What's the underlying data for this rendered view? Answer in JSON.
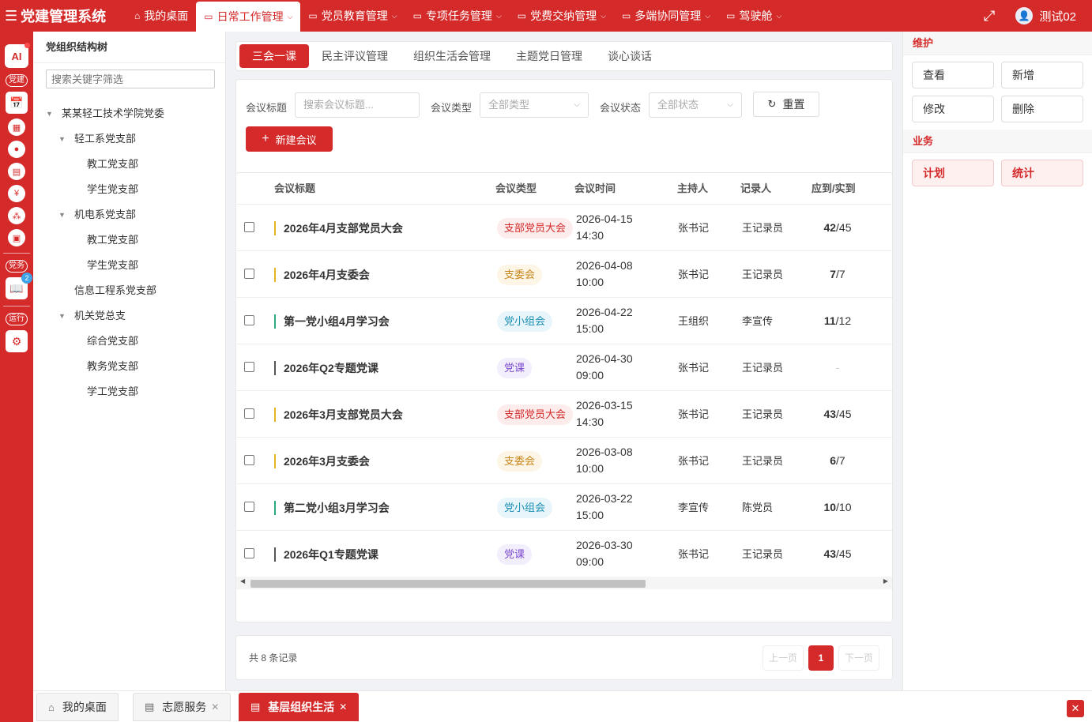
{
  "app": {
    "title": "党建管理系统",
    "username": "测试02"
  },
  "topnav": [
    {
      "label": "我的桌面",
      "icon": "home-icon"
    },
    {
      "label": "日常工作管理",
      "icon": "folder-icon",
      "active": true,
      "has_menu": true
    },
    {
      "label": "党员教育管理",
      "icon": "folder-icon",
      "has_menu": true
    },
    {
      "label": "专项任务管理",
      "icon": "folder-icon",
      "has_menu": true
    },
    {
      "label": "党费交纳管理",
      "icon": "folder-icon",
      "has_menu": true
    },
    {
      "label": "多端协同管理",
      "icon": "folder-icon",
      "has_menu": true
    },
    {
      "label": "驾驶舱",
      "icon": "folder-icon",
      "has_menu": true
    }
  ],
  "leftbar": {
    "ai_label": "AI",
    "section1": "党建",
    "section2": "党务",
    "section3": "运行",
    "badge": "2"
  },
  "tree": {
    "title": "党组织结构树",
    "search_placeholder": "搜索关键字筛选",
    "nodes": [
      {
        "label": "某某轻工技术学院党委",
        "level": 0,
        "caret": true
      },
      {
        "label": "轻工系党支部",
        "level": 1,
        "caret": true
      },
      {
        "label": "教工党支部",
        "level": 2,
        "caret": false
      },
      {
        "label": "学生党支部",
        "level": 2,
        "caret": false
      },
      {
        "label": "机电系党支部",
        "level": 1,
        "caret": true
      },
      {
        "label": "教工党支部",
        "level": 2,
        "caret": false
      },
      {
        "label": "学生党支部",
        "level": 2,
        "caret": false
      },
      {
        "label": "信息工程系党支部",
        "level": 1,
        "caret": false
      },
      {
        "label": "机关党总支",
        "level": 1,
        "caret": true
      },
      {
        "label": "综合党支部",
        "level": 2,
        "caret": false
      },
      {
        "label": "教务党支部",
        "level": 2,
        "caret": false
      },
      {
        "label": "学工党支部",
        "level": 2,
        "caret": false
      }
    ]
  },
  "subtabs": [
    {
      "label": "三会一课",
      "active": true
    },
    {
      "label": "民主评议管理"
    },
    {
      "label": "组织生活会管理"
    },
    {
      "label": "主题党日管理"
    },
    {
      "label": "谈心谈话"
    }
  ],
  "filters": {
    "title_label": "会议标题",
    "title_placeholder": "搜索会议标题...",
    "type_label": "会议类型",
    "type_value": "全部类型",
    "status_label": "会议状态",
    "status_value": "全部状态",
    "reset_label": "重置",
    "new_label": "新建会议"
  },
  "table": {
    "headers": {
      "title": "会议标题",
      "type": "会议类型",
      "time": "会议时间",
      "host": "主持人",
      "recorder": "记录人",
      "attendance": "应到/实到"
    },
    "rows": [
      {
        "title": "2026年4月支部党员大会",
        "type": "支部党员大会",
        "date": "2026-04-15",
        "time": "14:30",
        "host": "张书记",
        "recorder": "王记录员",
        "actual": "42",
        "expected": "/45"
      },
      {
        "title": "2026年4月支委会",
        "type": "支委会",
        "date": "2026-04-08",
        "time": "10:00",
        "host": "张书记",
        "recorder": "王记录员",
        "actual": "7",
        "expected": "/7"
      },
      {
        "title": "第一党小组4月学习会",
        "type": "党小组会",
        "date": "2026-04-22",
        "time": "15:00",
        "host": "王组织",
        "recorder": "李宣传",
        "actual": "11",
        "expected": "/12"
      },
      {
        "title": "2026年Q2专题党课",
        "type": "党课",
        "date": "2026-04-30",
        "time": "09:00",
        "host": "张书记",
        "recorder": "王记录员",
        "actual": "",
        "expected": "",
        "empty": "-"
      },
      {
        "title": "2026年3月支部党员大会",
        "type": "支部党员大会",
        "date": "2026-03-15",
        "time": "14:30",
        "host": "张书记",
        "recorder": "王记录员",
        "actual": "43",
        "expected": "/45"
      },
      {
        "title": "2026年3月支委会",
        "type": "支委会",
        "date": "2026-03-08",
        "time": "10:00",
        "host": "张书记",
        "recorder": "王记录员",
        "actual": "6",
        "expected": "/7"
      },
      {
        "title": "第二党小组3月学习会",
        "type": "党小组会",
        "date": "2026-03-22",
        "time": "15:00",
        "host": "李宣传",
        "recorder": "陈党员",
        "actual": "10",
        "expected": "/10"
      },
      {
        "title": "2026年Q1专题党课",
        "type": "党课",
        "date": "2026-03-30",
        "time": "09:00",
        "host": "张书记",
        "recorder": "王记录员",
        "actual": "43",
        "expected": "/45"
      }
    ]
  },
  "type_colors": {
    "支部党员大会": {
      "fg": "#d42a2a",
      "bg": "#fdecec",
      "bar": "#e6b422"
    },
    "支委会": {
      "fg": "#c8861a",
      "bg": "#fdf5e6",
      "bar": "#e6b422"
    },
    "党小组会": {
      "fg": "#1a8fb5",
      "bg": "#e8f5fa",
      "bar": "#2aa97c"
    },
    "党课": {
      "fg": "#7d4ccf",
      "bg": "#f3eefc",
      "bar": "#555555"
    }
  },
  "pager": {
    "total": "共 8 条记录",
    "prev": "上一页",
    "current": "1",
    "next": "下一页"
  },
  "rightpanel": {
    "maint_title": "维护",
    "view": "查看",
    "add": "新增",
    "edit": "修改",
    "delete": "删除",
    "biz_title": "业务",
    "plan": "计划",
    "stats": "统计"
  },
  "bottomtabs": [
    {
      "label": "我的桌面",
      "icon": "home-icon",
      "closable": false
    },
    {
      "label": "志愿服务",
      "icon": "doc-icon",
      "closable": true
    },
    {
      "label": "基层组织生活",
      "icon": "doc-icon",
      "closable": true,
      "active": true
    }
  ]
}
